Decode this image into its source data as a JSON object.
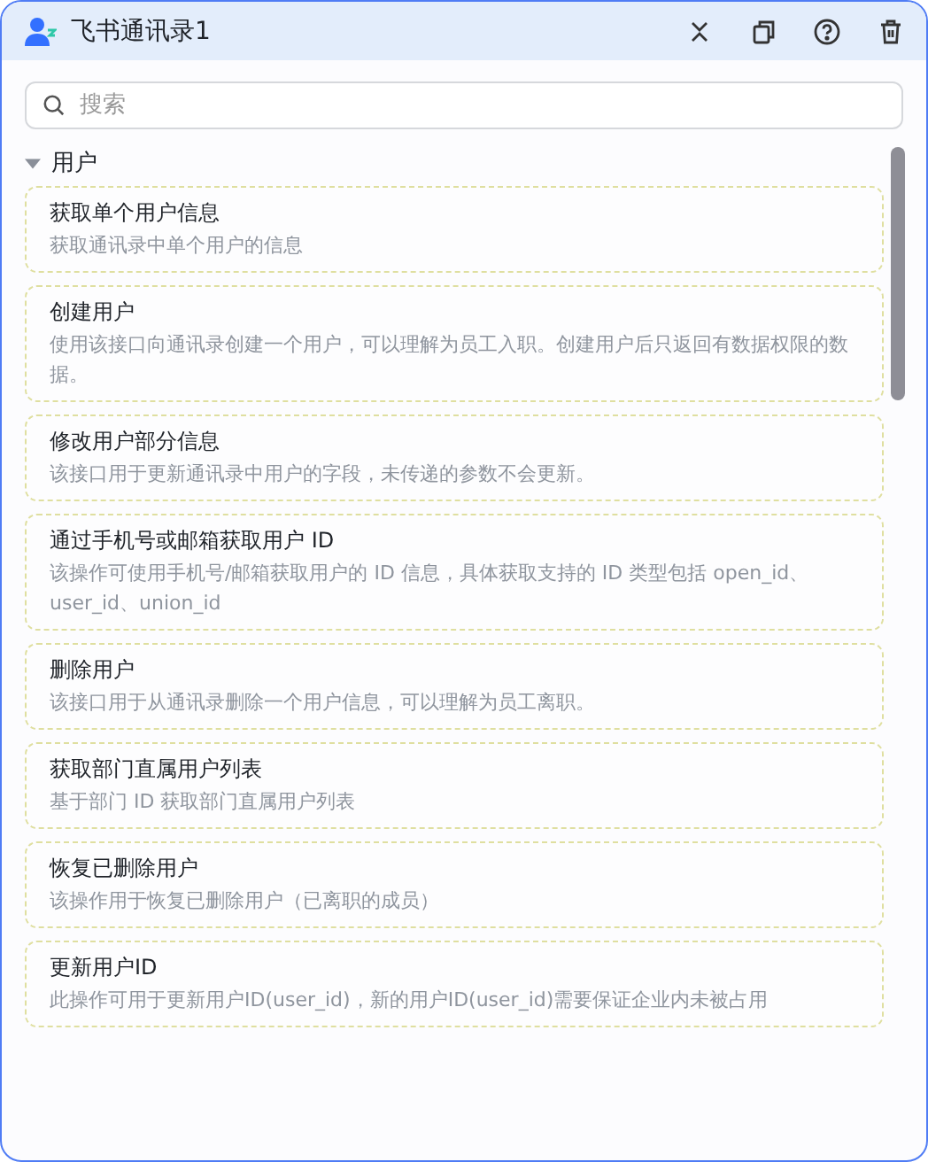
{
  "window": {
    "title": "飞书通讯录1"
  },
  "search": {
    "placeholder": "搜索"
  },
  "section": {
    "label": "用户",
    "expanded": true
  },
  "items": [
    {
      "title": "获取单个用户信息",
      "description": "获取通讯录中单个用户的信息"
    },
    {
      "title": "创建用户",
      "description": "使用该接口向通讯录创建一个用户，可以理解为员工入职。创建用户后只返回有数据权限的数据。"
    },
    {
      "title": "修改用户部分信息",
      "description": "该接口用于更新通讯录中用户的字段，未传递的参数不会更新。"
    },
    {
      "title": "通过手机号或邮箱获取用户 ID",
      "description": "该操作可使用手机号/邮箱获取用户的 ID 信息，具体获取支持的 ID 类型包括 open_id、user_id、union_id"
    },
    {
      "title": "删除用户",
      "description": "该接口用于从通讯录删除一个用户信息，可以理解为员工离职。"
    },
    {
      "title": "获取部门直属用户列表",
      "description": "基于部门 ID 获取部门直属用户列表"
    },
    {
      "title": "恢复已删除用户",
      "description": "该操作用于恢复已删除用户（已离职的成员）"
    },
    {
      "title": "更新用户ID",
      "description": "此操作可用于更新用户ID(user_id)，新的用户ID(user_id)需要保证企业内未被占用"
    }
  ]
}
